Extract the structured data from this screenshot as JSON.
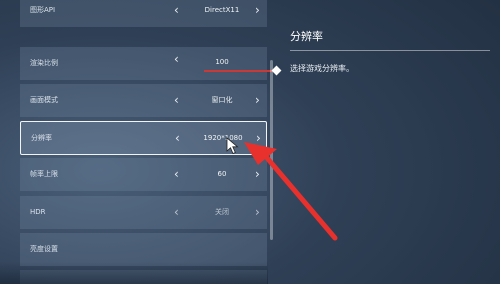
{
  "settings": {
    "rows": [
      {
        "label": "图形API",
        "value": "DirectX11",
        "type": "select"
      },
      {
        "label": "渲染比例",
        "value": "100",
        "type": "slider",
        "level": 1.0
      },
      {
        "label": "画面模式",
        "value": "窗口化",
        "type": "select"
      },
      {
        "label": "分辨率",
        "value": "1920*1080",
        "type": "select",
        "selected": true
      },
      {
        "label": "帧率上限",
        "value": "60",
        "type": "select"
      },
      {
        "label": "HDR",
        "value": "关闭",
        "type": "select",
        "disabled": true
      },
      {
        "label": "亮度设置",
        "value": "",
        "type": "link"
      }
    ]
  },
  "detail": {
    "title": "分辨率",
    "description": "选择游戏分辨率。"
  },
  "colors": {
    "slider_fill": "#c83a38",
    "annotation_arrow": "#e8312c",
    "selected_border": "#f2f5f8"
  },
  "icons": {
    "left": "chevron-left-icon",
    "right": "chevron-right-icon",
    "cursor": "mouse-cursor-icon"
  }
}
